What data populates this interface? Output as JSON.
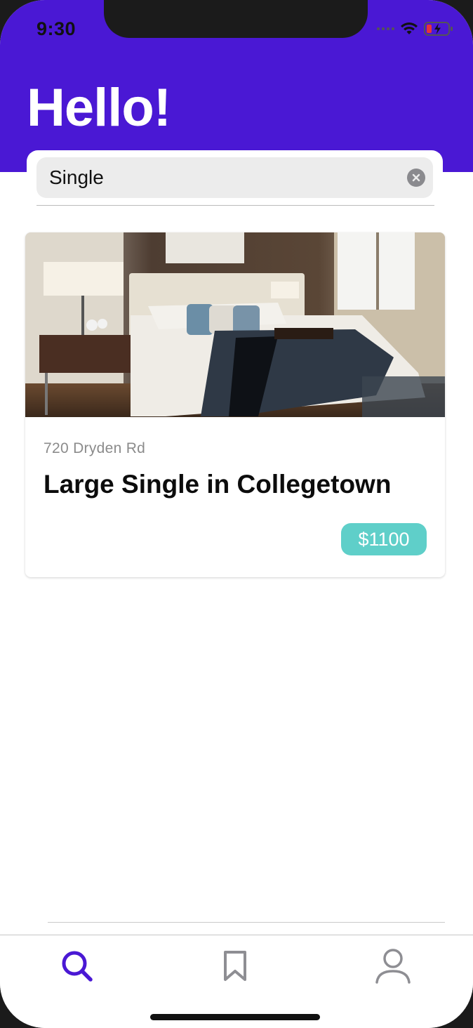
{
  "status_bar": {
    "time": "9:30"
  },
  "header": {
    "greeting": "Hello!"
  },
  "search": {
    "query": "Single"
  },
  "listings": [
    {
      "address": "720 Dryden Rd",
      "title": "Large Single in Collegetown",
      "price": "$1100"
    }
  ],
  "tabbar": {
    "items": [
      {
        "name": "search",
        "icon": "search-icon",
        "active": true
      },
      {
        "name": "saved",
        "icon": "bookmark-icon",
        "active": false
      },
      {
        "name": "profile",
        "icon": "person-icon",
        "active": false
      }
    ]
  },
  "colors": {
    "accent": "#4a18d4",
    "price_badge": "#5fcfc9",
    "inactive_icon": "#8e8e93"
  }
}
